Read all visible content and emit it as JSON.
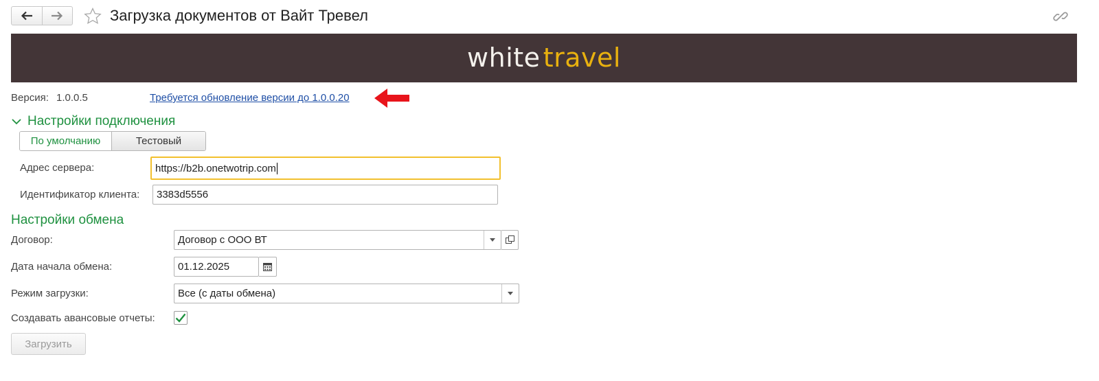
{
  "window": {
    "title": "Загрузка документов от Вайт Тревел",
    "icons": [
      "arrow-left-icon",
      "arrow-right-icon",
      "star-icon",
      "link-icon"
    ]
  },
  "banner": {
    "logo_word1": "white",
    "logo_word2": "travel",
    "background": "#433537",
    "accent": "#e8b10f"
  },
  "version": {
    "label": "Версия:",
    "value": "1.0.0.5",
    "update_link": "Требуется обновление версии до 1.0.0.20"
  },
  "connection": {
    "header": "Настройки подключения",
    "modes": [
      "По умолчанию",
      "Тестовый"
    ],
    "active_mode": "По умолчанию",
    "server_label": "Адрес сервера:",
    "server_value": "https://b2b.onetwotrip.com",
    "client_label": "Идентификатор клиента:",
    "client_value": "3383d5556"
  },
  "exchange": {
    "header": "Настройки обмена",
    "contract_label": "Договор:",
    "contract_value": "Договор с ООО ВТ",
    "start_date_label": "Дата начала обмена:",
    "start_date_value": "01.12.2025",
    "mode_label": "Режим загрузки:",
    "mode_value": "Все (с даты обмена)",
    "advance_reports_label": "Создавать авансовые отчеты:",
    "advance_reports_checked": true
  },
  "actions": {
    "load_label": "Загрузить"
  },
  "colors": {
    "group_header": "#1f9140",
    "link": "#1f4fa6",
    "focus_border": "#f2c02d",
    "annotation_arrow": "#e8141b"
  }
}
